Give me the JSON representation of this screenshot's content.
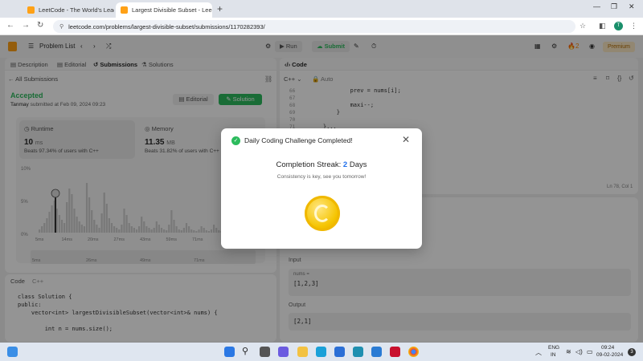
{
  "browser": {
    "tabs": [
      {
        "title": "LeetCode - The World's Leadin",
        "active": false
      },
      {
        "title": "Largest Divisible Subset - Lee",
        "active": true
      }
    ],
    "url": "leetcode.com/problems/largest-divisible-subset/submissions/1170282393/"
  },
  "topbar": {
    "problem_list": "Problem List",
    "run": "Run",
    "submit": "Submit",
    "streak_count": "2",
    "premium": "Premium"
  },
  "left": {
    "tabs": [
      "Description",
      "Editorial",
      "Submissions",
      "Solutions"
    ],
    "all_submissions": "All Submissions",
    "status": "Accepted",
    "submitted_by": "Tanmay",
    "submitted_text": "submitted at Feb 09, 2024 09:23",
    "editorial_btn": "Editorial",
    "solution_btn": "Solution",
    "runtime": {
      "label": "Runtime",
      "value": "10",
      "unit": "ms",
      "beats": "Beats 97.34% of users with C++"
    },
    "memory": {
      "label": "Memory",
      "value": "11.35",
      "unit": "MB",
      "beats": "Beats 31.82% of users with C++"
    },
    "chart_y": [
      "10%",
      "5%",
      "0%"
    ],
    "chart_x": [
      "5ms",
      "14ms",
      "20ms",
      "27ms",
      "43ms",
      "59ms",
      "71ms"
    ],
    "mini_x": [
      "5ms",
      "26ms",
      "49ms",
      "71ms"
    ],
    "code_tab": "Code",
    "code_lang": "C++",
    "code_lines": [
      "class Solution {",
      "public:",
      "    vector<int> largestDivisibleSubset(vector<int>& nums) {",
      "",
      "        int n = nums.size();"
    ]
  },
  "right": {
    "code_title": "Code",
    "lang": "C++",
    "auto": "Auto",
    "line_numbers": [
      "66",
      "67",
      "68",
      "69",
      "70",
      "71"
    ],
    "code_lines": [
      "            prev = nums[i];",
      "",
      "            maxi--;",
      "        }",
      "",
      "    }..."
    ],
    "cursor_pos": "Ln 78, Col 1",
    "input_label": "Input",
    "input_var": "nums =",
    "input_value": "[1,2,3]",
    "output_label": "Output",
    "output_value": "[2,1]"
  },
  "modal": {
    "title": "Daily Coding Challenge Completed!",
    "streak_prefix": "Completion Streak:",
    "streak_num": "2",
    "streak_suffix": "Days",
    "message": "Consistency is key, see you tomorrow!"
  },
  "taskbar": {
    "lang_top": "ENG",
    "lang_bottom": "IN",
    "time": "09:24",
    "date": "09-02-2024",
    "notif": "3"
  },
  "chart_data": {
    "type": "bar",
    "title": "",
    "xlabel": "",
    "ylabel": "",
    "ylim": [
      0,
      10
    ],
    "categories": [
      "5ms",
      "14ms",
      "20ms",
      "27ms",
      "43ms",
      "59ms",
      "71ms"
    ]
  }
}
